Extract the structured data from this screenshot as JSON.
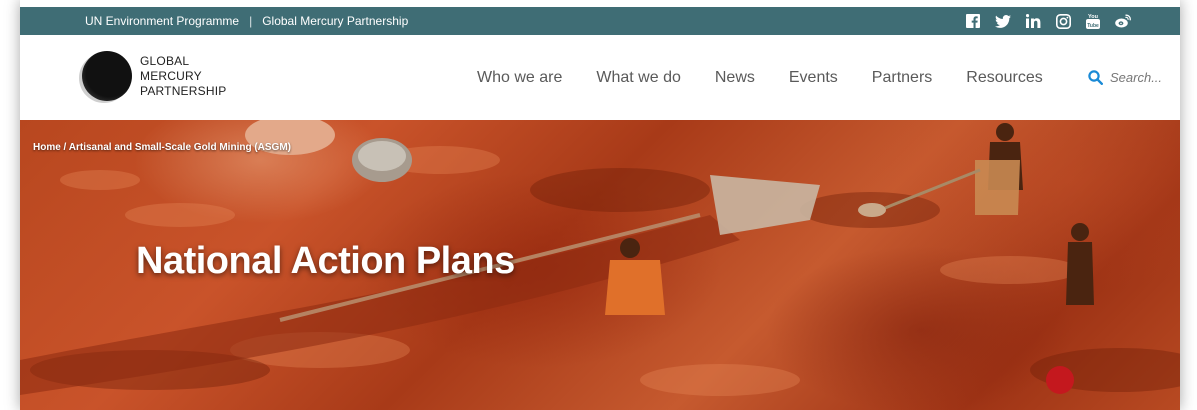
{
  "topbar": {
    "link1": "UN Environment Programme",
    "separator": "|",
    "link2": "Global Mercury Partnership",
    "background": "#3f6d75",
    "social": [
      "facebook-icon",
      "twitter-icon",
      "linkedin-icon",
      "instagram-icon",
      "youtube-icon",
      "weibo-icon"
    ]
  },
  "logo": {
    "line1": "GLOBAL",
    "line2": "MERCURY",
    "line3": "PARTNERSHIP"
  },
  "nav": {
    "items": [
      "Who we are",
      "What we do",
      "News",
      "Events",
      "Partners",
      "Resources"
    ]
  },
  "search": {
    "placeholder": "Search...",
    "accent": "#1a8ad6"
  },
  "hero": {
    "breadcrumb": "Home / Artisanal and Small-Scale Gold Mining (ASGM)",
    "title": "National Action Plans"
  }
}
